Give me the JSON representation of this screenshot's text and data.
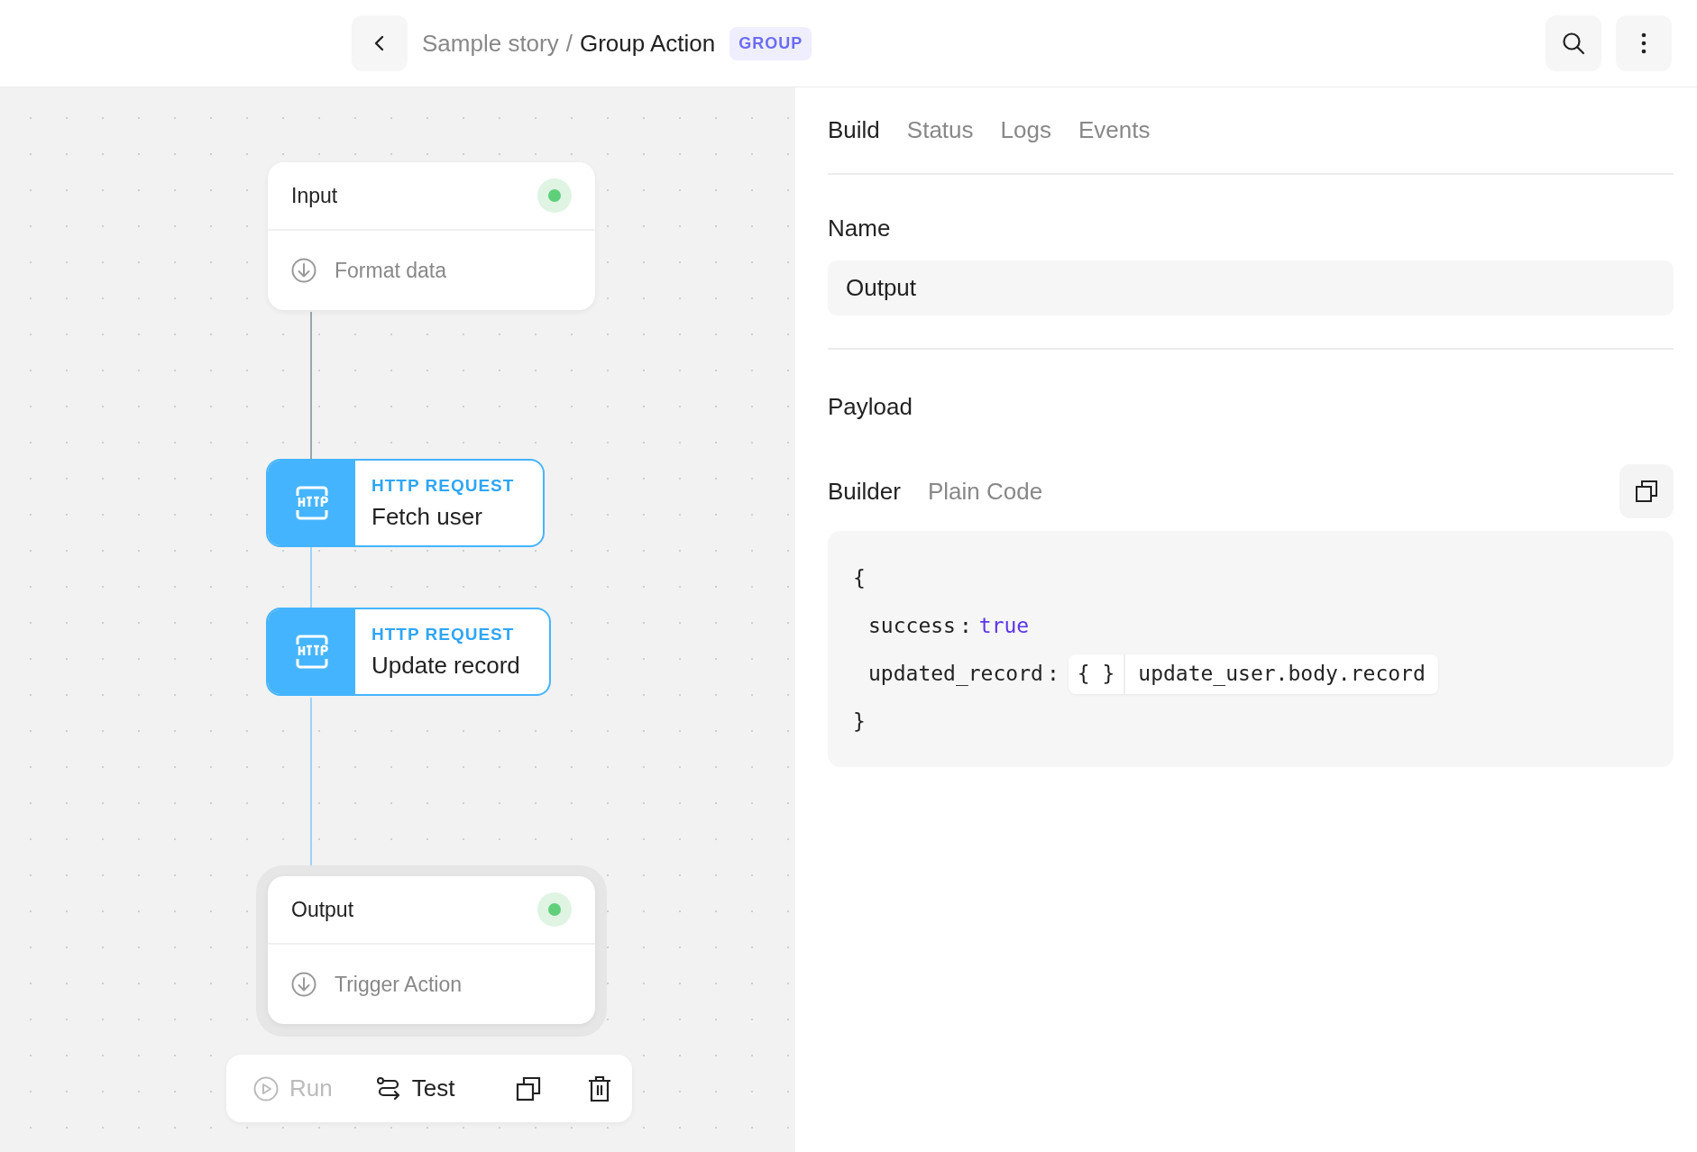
{
  "header": {
    "breadcrumb_parent": "Sample story",
    "separator": "/",
    "title": "Group Action",
    "badge": "GROUP"
  },
  "canvas": {
    "nodes": [
      {
        "kind": "trigger",
        "title": "Input",
        "action": "Format data",
        "selected": false
      },
      {
        "kind": "http",
        "type_label": "HTTP REQUEST",
        "title": "Fetch user",
        "selected": false
      },
      {
        "kind": "http",
        "type_label": "HTTP REQUEST",
        "title": "Update record",
        "selected": false
      },
      {
        "kind": "trigger",
        "title": "Output",
        "action": "Trigger Action",
        "selected": true
      }
    ],
    "toolbar": [
      {
        "kind": "run",
        "label": "Run",
        "disabled": true
      },
      {
        "kind": "test",
        "label": "Test",
        "disabled": false
      }
    ]
  },
  "panel": {
    "tabs": [
      {
        "label": "Build",
        "selected": true
      },
      {
        "label": "Status",
        "selected": false
      },
      {
        "label": "Logs",
        "selected": false
      },
      {
        "label": "Events",
        "selected": false
      }
    ],
    "name_label": "Name",
    "name_value": "Output",
    "payload_label": "Payload",
    "payload_tabs": [
      {
        "label": "Builder",
        "selected": true
      },
      {
        "label": "Plain Code",
        "selected": false
      }
    ],
    "code": [
      {
        "kind": "brace",
        "text": "{"
      },
      {
        "kind": "literal",
        "key": "success",
        "sep": ":",
        "value": "true"
      },
      {
        "kind": "reference",
        "key": "updated_record",
        "sep": ":",
        "ref_icon": "{ }",
        "value": "update_user.body.record"
      },
      {
        "kind": "brace",
        "text": "}"
      }
    ]
  }
}
